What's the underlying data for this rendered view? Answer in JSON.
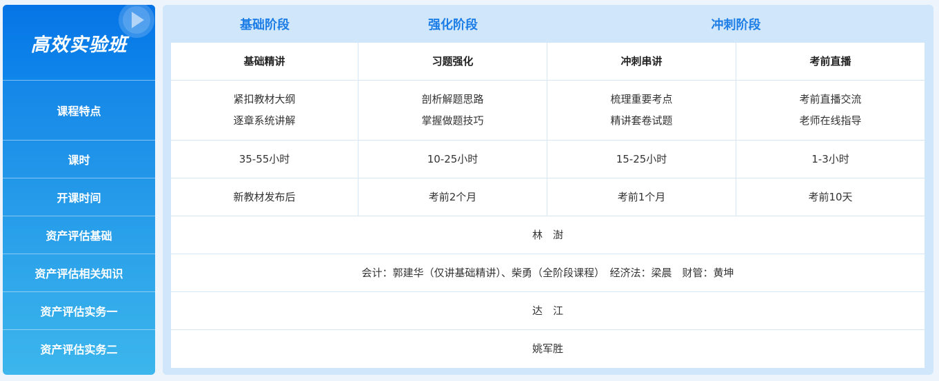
{
  "sidebar": {
    "title": "高效实验班",
    "rows": [
      "课程特点",
      "课时",
      "开课时间",
      "资产评估基础",
      "资产评估相关知识",
      "资产评估实务一",
      "资产评估实务二"
    ]
  },
  "phases": [
    "基础阶段",
    "强化阶段",
    "冲刺阶段"
  ],
  "columns": [
    "基础精讲",
    "习题强化",
    "冲刺串讲",
    "考前直播"
  ],
  "features": [
    [
      "紧扣教材大纲",
      "逐章系统讲解"
    ],
    [
      "剖析解题思路",
      "掌握做题技巧"
    ],
    [
      "梳理重要考点",
      "精讲套卷试题"
    ],
    [
      "考前直播交流",
      "老师在线指导"
    ]
  ],
  "hours": [
    "35-55小时",
    "10-25小时",
    "15-25小时",
    "1-3小时"
  ],
  "start_time": [
    "新教材发布后",
    "考前2个月",
    "考前1个月",
    "考前10天"
  ],
  "teachers": {
    "basics": "林　澍",
    "related": "会计：郭建华（仅讲基础精讲）、柴勇（全阶段课程）　经济法：梁晨　财管：黄坤",
    "practice1": "达　江",
    "practice2": "姚军胜"
  },
  "colors": {
    "accent": "#1d7de6",
    "sidebar_top": "#0a7ae8",
    "sidebar_bottom": "#3cb6ec",
    "panel": "#cfe6fb"
  },
  "icons": {
    "play": "play-icon"
  }
}
